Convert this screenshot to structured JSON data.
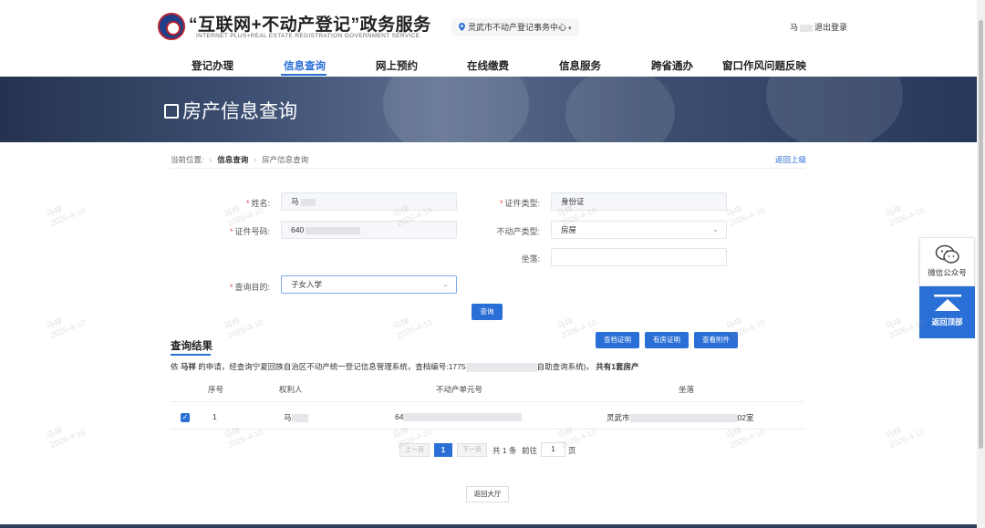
{
  "header": {
    "title": "“互联网+不动产登记”政务服务",
    "subtitle": "INTERNET PLUS+REAL ESTATE REGISTRATION GOVERNMENT SERVICE",
    "location": "灵武市不动产登记事务中心",
    "user_name": "马",
    "logout": "退出登录"
  },
  "nav": {
    "items": [
      "登记办理",
      "信息查询",
      "网上预约",
      "在线缴费",
      "信息服务",
      "跨省通办",
      "窗口作风问题反映"
    ],
    "active": "信息查询"
  },
  "banner": {
    "title": "房产信息查询"
  },
  "breadcrumb": {
    "prefix": "当前位置:",
    "level1": "信息查询",
    "level2": "房产信息查询",
    "back": "返回上级"
  },
  "form": {
    "name_label": "姓名:",
    "name_value": "马",
    "id_type_label": "证件类型:",
    "id_type_value": "身份证",
    "id_no_label": "证件号码:",
    "id_no_value": "640",
    "property_type_label": "不动产类型:",
    "property_type_value": "房屋",
    "location_label": "坐落:",
    "location_value": "",
    "purpose_label": "查询目的:",
    "purpose_value": "子女入学",
    "query_button": "查询"
  },
  "results": {
    "title": "查询结果",
    "buttons": [
      "查档证明",
      "有房证明",
      "查看附件"
    ],
    "desc_prefix": "依",
    "desc_name": "马祥",
    "desc_mid": "的申请，经查询宁夏回族自治区不动产统一登记信息管理系统，查档编号:1775",
    "desc_suffix": "自助查询系统)，",
    "desc_total": "共有1套房产",
    "columns": [
      "序号",
      "权利人",
      "不动产单元号",
      "坐落"
    ],
    "rows": [
      {
        "index": "1",
        "owner": "马",
        "unit_no": "64",
        "location_prefix": "灵武市",
        "location_suffix": "02室"
      }
    ]
  },
  "pagination": {
    "prev": "上一页",
    "current": "1",
    "next": "下一页",
    "total": "共 1 条",
    "goto": "前往",
    "page_input": "1",
    "page_unit": "页"
  },
  "footer": {
    "back_hall": "返回大厅"
  },
  "float": {
    "wechat": "微信公众号",
    "top": "返回顶部"
  },
  "watermark": {
    "name": "马祥",
    "date": "2026-4-10"
  },
  "colors": {
    "primary": "#2a6fd6",
    "required": "#e24848",
    "banner": "#3d4f72"
  }
}
